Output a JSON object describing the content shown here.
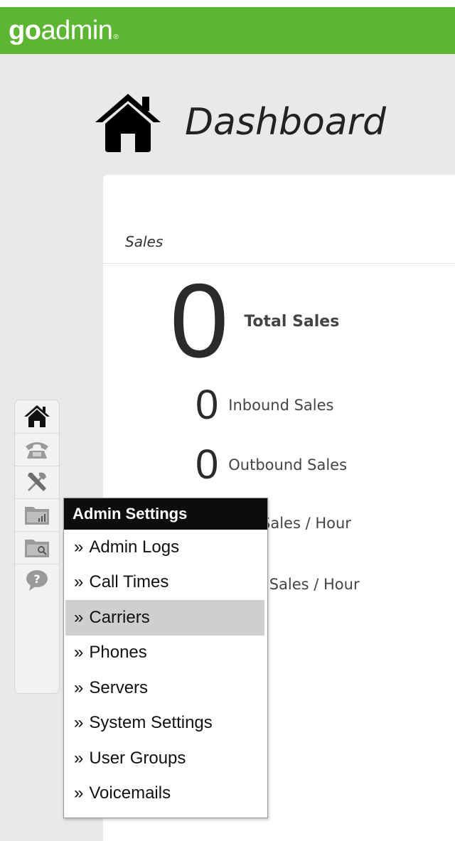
{
  "brand": {
    "logo_go": "go",
    "logo_admin": "admin",
    "logo_mark": "®"
  },
  "page": {
    "title": "Dashboard"
  },
  "sales": {
    "section_title": "Sales",
    "total": {
      "value": "0",
      "label": "Total Sales"
    },
    "inbound": {
      "value": "0",
      "label": "Inbound Sales"
    },
    "outbound": {
      "value": "0",
      "label": "Outbound Sales"
    },
    "per_hour_label": "Sales / Hour",
    "it_per_hour_label": "IT Sales / Hour"
  },
  "toolbar": {
    "icons": [
      "home-icon",
      "phone-icon",
      "tools-icon",
      "folder-chart-icon",
      "folder-search-icon",
      "help-icon"
    ]
  },
  "admin_menu": {
    "header": "Admin Settings",
    "items": [
      {
        "label": "Admin Logs",
        "active": false
      },
      {
        "label": "Call Times",
        "active": false
      },
      {
        "label": "Carriers",
        "active": true
      },
      {
        "label": "Phones",
        "active": false
      },
      {
        "label": "Servers",
        "active": false
      },
      {
        "label": "System Settings",
        "active": false
      },
      {
        "label": "User Groups",
        "active": false
      },
      {
        "label": "Voicemails",
        "active": false
      }
    ],
    "prefix": "»"
  },
  "colors": {
    "brand_green": "#5cb631",
    "menu_header_bg": "#0d0d0d",
    "active_item_bg": "#cfcfcf"
  }
}
